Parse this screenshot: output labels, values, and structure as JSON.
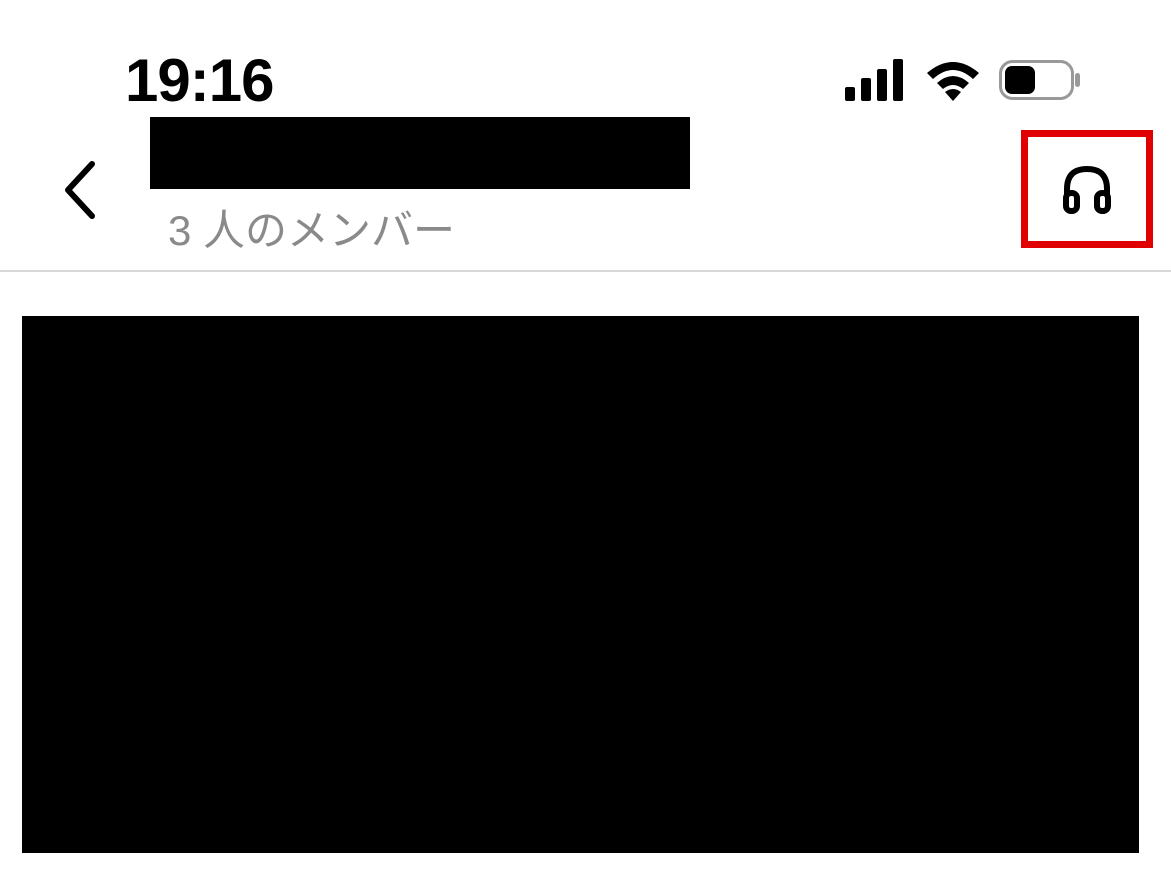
{
  "status_bar": {
    "time": "19:16"
  },
  "header": {
    "subtitle": "3 人のメンバー"
  }
}
